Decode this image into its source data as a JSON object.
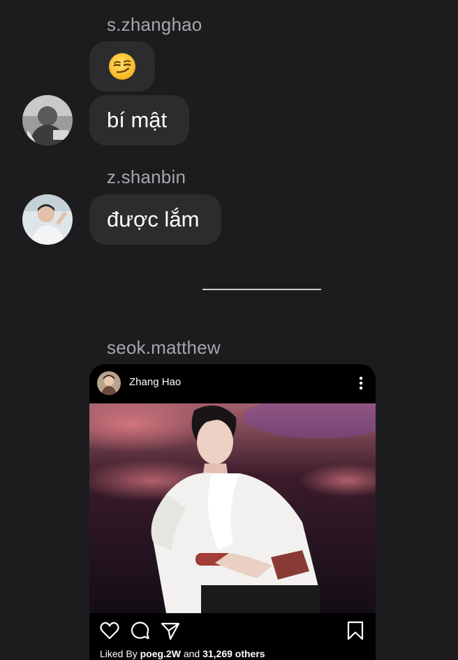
{
  "messages": [
    {
      "sender": "s.zhanghao",
      "bubbles": [
        "😏",
        "bí mật"
      ]
    },
    {
      "sender": "z.shanbin",
      "bubbles": [
        "được lắm"
      ]
    },
    {
      "sender": "seok.matthew"
    }
  ],
  "shared_post": {
    "author": "Zhang Hao",
    "likes_prefix": "Liked By",
    "liked_by_user": "poeg.2W",
    "likes_join": "and",
    "others_count": "31,269 others"
  },
  "icons": {
    "more": "more-vertical-icon",
    "like": "heart-icon",
    "comment": "comment-bubble-icon",
    "share": "paper-plane-icon",
    "save": "bookmark-icon"
  },
  "colors": {
    "background": "#1c1c1e",
    "bubble": "#2c2c2e",
    "sender_name": "#a6a6ab",
    "post_background": "#000000"
  }
}
